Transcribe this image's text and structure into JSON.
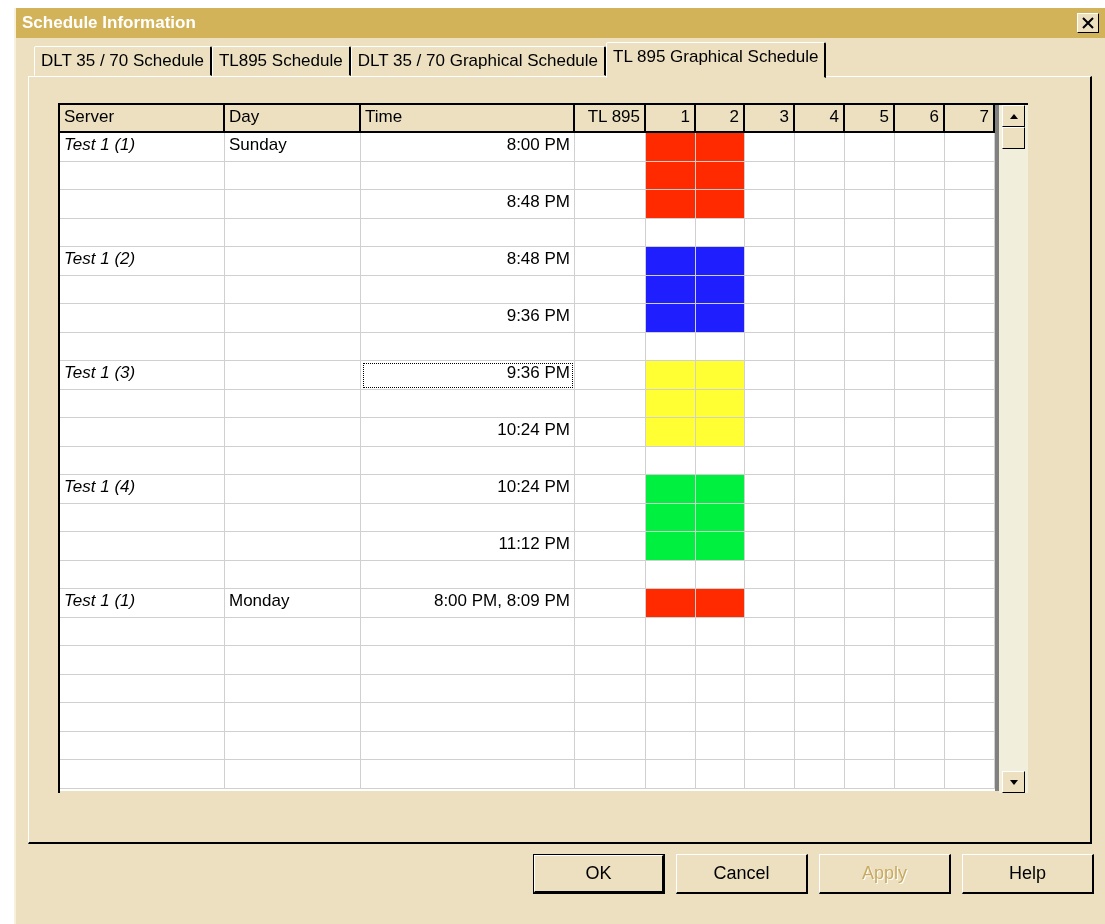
{
  "window": {
    "title": "Schedule Information"
  },
  "tabs": [
    {
      "label": "DLT 35 / 70 Schedule",
      "selected": false
    },
    {
      "label": "TL895 Schedule",
      "selected": false
    },
    {
      "label": "DLT 35 / 70 Graphical Schedule",
      "selected": false
    },
    {
      "label": "TL 895 Graphical Schedule",
      "selected": true
    }
  ],
  "table": {
    "columns": [
      "Server",
      "Day",
      "Time",
      "TL 895",
      "1",
      "2",
      "3",
      "4",
      "5",
      "6",
      "7"
    ],
    "rows": [
      {
        "server": "Test 1 (1)",
        "day": "Sunday",
        "time": "8:00 PM",
        "color": "#ff2a00",
        "filled": [
          false,
          true,
          true,
          false,
          false,
          false,
          false,
          false
        ],
        "focused": false
      },
      {
        "color": "#ff2a00",
        "filled": [
          false,
          true,
          true,
          false,
          false,
          false,
          false,
          false
        ],
        "focused": false
      },
      {
        "time": "8:48 PM",
        "color": "#ff2a00",
        "filled": [
          false,
          true,
          true,
          false,
          false,
          false,
          false,
          false
        ],
        "focused": false
      },
      {
        "focused": false
      },
      {
        "server": "Test 1 (2)",
        "time": "8:48 PM",
        "color": "#1e1eff",
        "filled": [
          false,
          true,
          true,
          false,
          false,
          false,
          false,
          false
        ],
        "focused": false
      },
      {
        "color": "#1e1eff",
        "filled": [
          false,
          true,
          true,
          false,
          false,
          false,
          false,
          false
        ],
        "focused": false
      },
      {
        "time": "9:36 PM",
        "color": "#1e1eff",
        "filled": [
          false,
          true,
          true,
          false,
          false,
          false,
          false,
          false
        ],
        "focused": false
      },
      {
        "focused": false
      },
      {
        "server": "Test 1 (3)",
        "time": "9:36 PM",
        "color": "#ffff33",
        "filled": [
          false,
          true,
          true,
          false,
          false,
          false,
          false,
          false
        ],
        "focused": true
      },
      {
        "color": "#ffff33",
        "filled": [
          false,
          true,
          true,
          false,
          false,
          false,
          false,
          false
        ],
        "focused": false
      },
      {
        "time": "10:24 PM",
        "color": "#ffff33",
        "filled": [
          false,
          true,
          true,
          false,
          false,
          false,
          false,
          false
        ],
        "focused": false
      },
      {
        "focused": false
      },
      {
        "server": "Test 1 (4)",
        "time": "10:24 PM",
        "color": "#00f040",
        "filled": [
          false,
          true,
          true,
          false,
          false,
          false,
          false,
          false
        ],
        "focused": false
      },
      {
        "color": "#00f040",
        "filled": [
          false,
          true,
          true,
          false,
          false,
          false,
          false,
          false
        ],
        "focused": false
      },
      {
        "time": "11:12 PM",
        "color": "#00f040",
        "filled": [
          false,
          true,
          true,
          false,
          false,
          false,
          false,
          false
        ],
        "focused": false
      },
      {
        "focused": false
      },
      {
        "server": "Test 1 (1)",
        "day": "Monday",
        "time": "8:00 PM, 8:09 PM",
        "color": "#ff2a00",
        "filled": [
          false,
          true,
          true,
          false,
          false,
          false,
          false,
          false
        ],
        "focused": false
      }
    ]
  },
  "buttons": [
    {
      "label": "OK",
      "disabled": false,
      "default": true
    },
    {
      "label": "Cancel",
      "disabled": false,
      "default": false
    },
    {
      "label": "Apply",
      "disabled": true,
      "default": false
    },
    {
      "label": "Help",
      "disabled": false,
      "default": false
    }
  ]
}
